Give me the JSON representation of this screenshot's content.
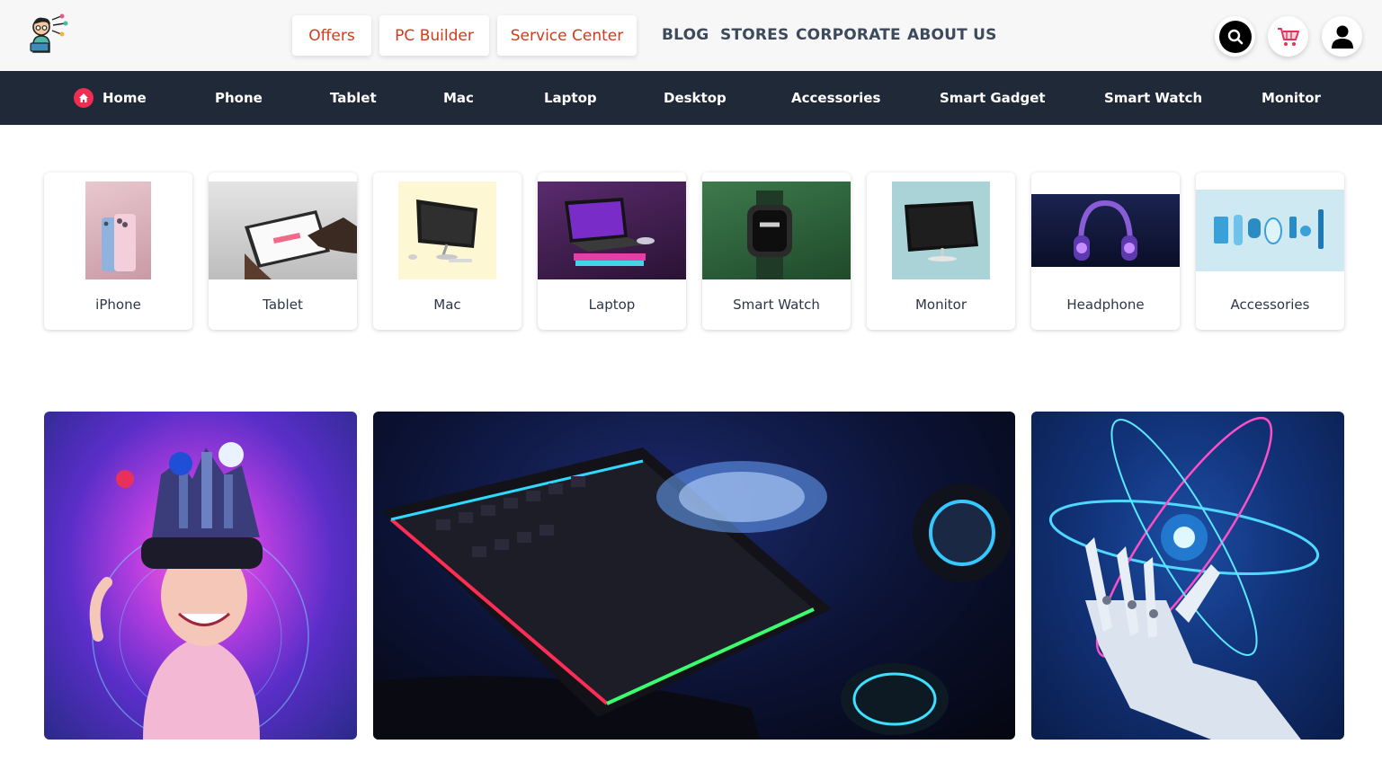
{
  "header": {
    "logo_icon": "mascot-logo-icon",
    "pills": [
      {
        "label": "Offers"
      },
      {
        "label": "PC Builder"
      },
      {
        "label": "Service Center"
      }
    ],
    "links": [
      {
        "label": "BLOG"
      },
      {
        "label": "STORES"
      },
      {
        "label": "CORPORATE"
      },
      {
        "label": "ABOUT US"
      }
    ],
    "actions": [
      {
        "icon": "search-icon"
      },
      {
        "icon": "cart-icon"
      },
      {
        "icon": "user-icon"
      }
    ],
    "accent_color": "#d23a1c"
  },
  "nav": {
    "background": "#1f2937",
    "items": [
      {
        "label": "Home",
        "icon": "home-icon"
      },
      {
        "label": "Phone"
      },
      {
        "label": "Tablet"
      },
      {
        "label": "Mac"
      },
      {
        "label": "Laptop"
      },
      {
        "label": "Desktop"
      },
      {
        "label": "Accessories"
      },
      {
        "label": "Smart Gadget"
      },
      {
        "label": "Smart Watch"
      },
      {
        "label": "Monitor"
      }
    ]
  },
  "categories": [
    {
      "label": "iPhone"
    },
    {
      "label": "Tablet"
    },
    {
      "label": "Mac"
    },
    {
      "label": "Laptop"
    },
    {
      "label": "Smart Watch"
    },
    {
      "label": "Monitor"
    },
    {
      "label": "Headphone"
    },
    {
      "label": "Accessories"
    }
  ],
  "banners": [
    {
      "name": "vr-metaverse-banner"
    },
    {
      "name": "gaming-setup-banner"
    },
    {
      "name": "robot-hand-atom-banner"
    }
  ]
}
